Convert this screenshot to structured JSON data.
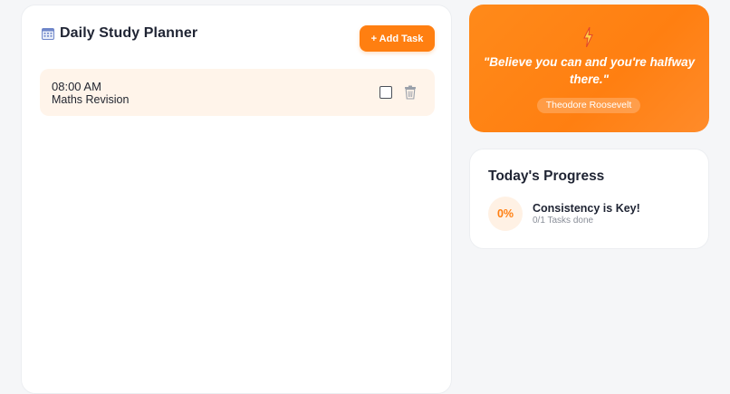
{
  "planner": {
    "title": "Daily Study Planner",
    "add_task_label": "+ Add Task",
    "calendar_icon": "calendar-icon",
    "tasks": [
      {
        "time": "08:00 AM",
        "name": "Maths Revision",
        "done": false,
        "delete_icon": "trash-icon"
      }
    ]
  },
  "quote": {
    "icon": "lightning-icon",
    "text": "\"Believe you can and you're halfway there.\"",
    "author": "Theodore Roosevelt"
  },
  "progress": {
    "title": "Today's Progress",
    "percent_label": "0%",
    "headline": "Consistency is Key!",
    "subtext": "0/1 Tasks done"
  },
  "colors": {
    "accent": "#ff7f11",
    "task_bg": "#fff4ea",
    "page_bg": "#f5f6f8"
  }
}
